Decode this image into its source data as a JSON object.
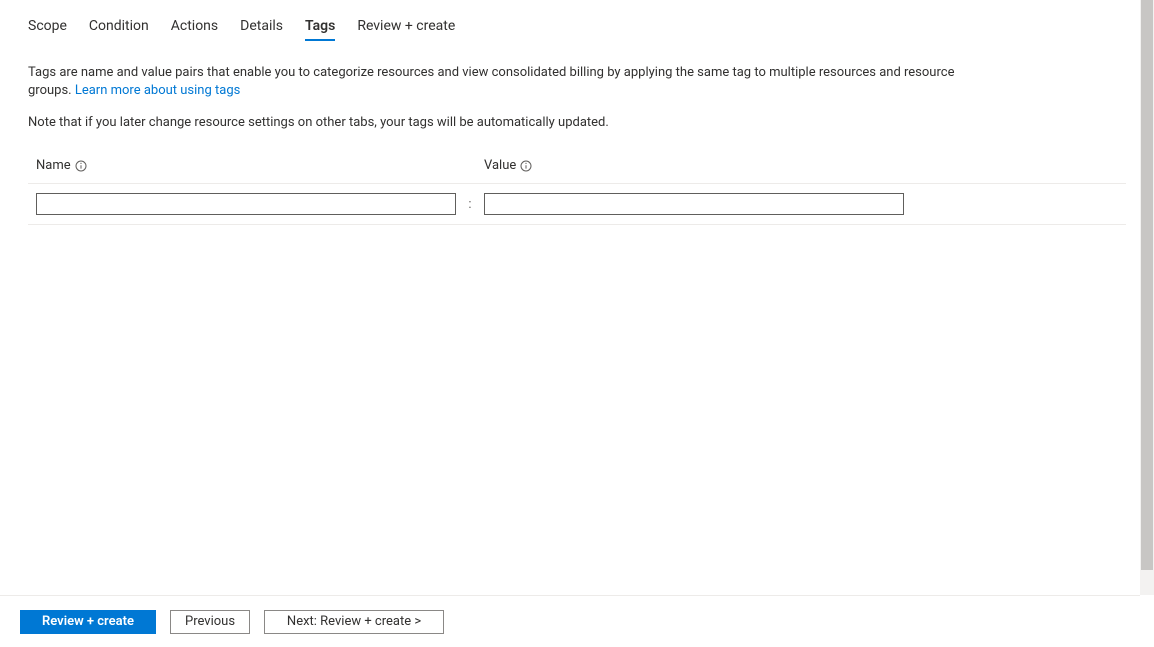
{
  "tabs": [
    {
      "label": "Scope"
    },
    {
      "label": "Condition"
    },
    {
      "label": "Actions"
    },
    {
      "label": "Details"
    },
    {
      "label": "Tags"
    },
    {
      "label": "Review + create"
    }
  ],
  "active_tab_index": 4,
  "intro": {
    "text_before": "Tags are name and value pairs that enable you to categorize resources and view consolidated billing by applying the same tag to multiple resources and resource groups. ",
    "link_text": "Learn more about using tags"
  },
  "note_text": "Note that if you later change resource settings on other tabs, your tags will be automatically updated.",
  "columns": {
    "name_label": "Name",
    "value_label": "Value"
  },
  "row": {
    "name_value": "",
    "value_value": "",
    "separator": ":"
  },
  "footer": {
    "review_create": "Review + create",
    "previous": "Previous",
    "next": "Next: Review + create >"
  }
}
